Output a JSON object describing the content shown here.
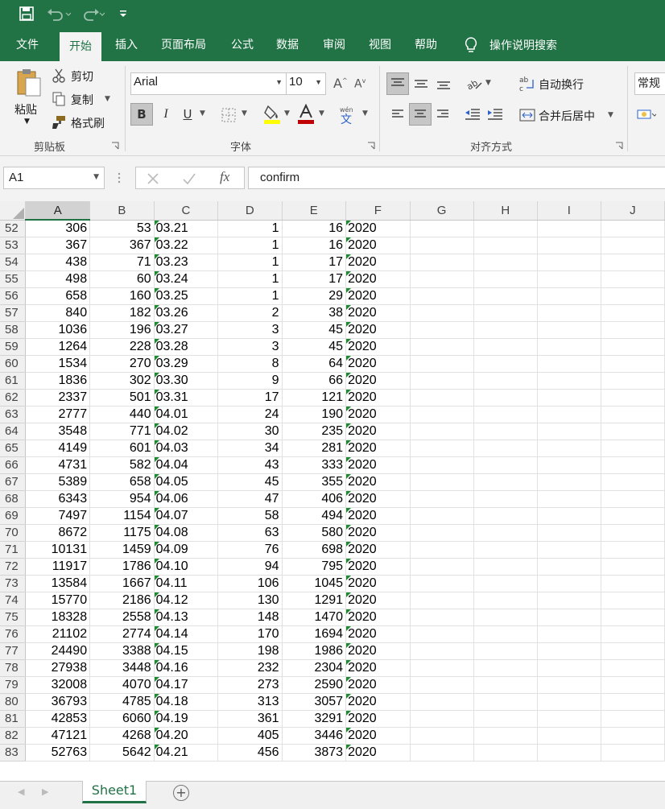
{
  "qat": {
    "save": "save-icon",
    "undo": "undo-icon",
    "redo": "redo-icon",
    "customize": "customize-qat-icon"
  },
  "menu": {
    "tabs": [
      "文件",
      "开始",
      "插入",
      "页面布局",
      "公式",
      "数据",
      "审阅",
      "视图",
      "帮助"
    ],
    "active_index": 1,
    "tellme": "操作说明搜索"
  },
  "ribbon": {
    "clipboard": {
      "paste": "粘贴",
      "cut": "剪切",
      "copy": "复制",
      "format_painter": "格式刷",
      "label": "剪贴板"
    },
    "font": {
      "name": "Arial",
      "size": "10",
      "bold": "B",
      "italic": "I",
      "underline": "U",
      "label": "字体"
    },
    "alignment": {
      "wrap": "自动换行",
      "merge": "合并后居中",
      "label": "对齐方式"
    },
    "number": {
      "format": "常规"
    }
  },
  "formula_bar": {
    "name_box": "A1",
    "fx": "fx",
    "content": "confirm"
  },
  "columns": [
    "A",
    "B",
    "C",
    "D",
    "E",
    "F",
    "G",
    "H",
    "I",
    "J"
  ],
  "rows": [
    {
      "r": "52",
      "a": "306",
      "b": "53",
      "c": "03.21",
      "d": "1",
      "e": "16",
      "f": "2020"
    },
    {
      "r": "53",
      "a": "367",
      "b": "367",
      "c": "03.22",
      "d": "1",
      "e": "16",
      "f": "2020"
    },
    {
      "r": "54",
      "a": "438",
      "b": "71",
      "c": "03.23",
      "d": "1",
      "e": "17",
      "f": "2020"
    },
    {
      "r": "55",
      "a": "498",
      "b": "60",
      "c": "03.24",
      "d": "1",
      "e": "17",
      "f": "2020"
    },
    {
      "r": "56",
      "a": "658",
      "b": "160",
      "c": "03.25",
      "d": "1",
      "e": "29",
      "f": "2020"
    },
    {
      "r": "57",
      "a": "840",
      "b": "182",
      "c": "03.26",
      "d": "2",
      "e": "38",
      "f": "2020"
    },
    {
      "r": "58",
      "a": "1036",
      "b": "196",
      "c": "03.27",
      "d": "3",
      "e": "45",
      "f": "2020"
    },
    {
      "r": "59",
      "a": "1264",
      "b": "228",
      "c": "03.28",
      "d": "3",
      "e": "45",
      "f": "2020"
    },
    {
      "r": "60",
      "a": "1534",
      "b": "270",
      "c": "03.29",
      "d": "8",
      "e": "64",
      "f": "2020"
    },
    {
      "r": "61",
      "a": "1836",
      "b": "302",
      "c": "03.30",
      "d": "9",
      "e": "66",
      "f": "2020"
    },
    {
      "r": "62",
      "a": "2337",
      "b": "501",
      "c": "03.31",
      "d": "17",
      "e": "121",
      "f": "2020"
    },
    {
      "r": "63",
      "a": "2777",
      "b": "440",
      "c": "04.01",
      "d": "24",
      "e": "190",
      "f": "2020"
    },
    {
      "r": "64",
      "a": "3548",
      "b": "771",
      "c": "04.02",
      "d": "30",
      "e": "235",
      "f": "2020"
    },
    {
      "r": "65",
      "a": "4149",
      "b": "601",
      "c": "04.03",
      "d": "34",
      "e": "281",
      "f": "2020"
    },
    {
      "r": "66",
      "a": "4731",
      "b": "582",
      "c": "04.04",
      "d": "43",
      "e": "333",
      "f": "2020"
    },
    {
      "r": "67",
      "a": "5389",
      "b": "658",
      "c": "04.05",
      "d": "45",
      "e": "355",
      "f": "2020"
    },
    {
      "r": "68",
      "a": "6343",
      "b": "954",
      "c": "04.06",
      "d": "47",
      "e": "406",
      "f": "2020"
    },
    {
      "r": "69",
      "a": "7497",
      "b": "1154",
      "c": "04.07",
      "d": "58",
      "e": "494",
      "f": "2020"
    },
    {
      "r": "70",
      "a": "8672",
      "b": "1175",
      "c": "04.08",
      "d": "63",
      "e": "580",
      "f": "2020"
    },
    {
      "r": "71",
      "a": "10131",
      "b": "1459",
      "c": "04.09",
      "d": "76",
      "e": "698",
      "f": "2020"
    },
    {
      "r": "72",
      "a": "11917",
      "b": "1786",
      "c": "04.10",
      "d": "94",
      "e": "795",
      "f": "2020"
    },
    {
      "r": "73",
      "a": "13584",
      "b": "1667",
      "c": "04.11",
      "d": "106",
      "e": "1045",
      "f": "2020"
    },
    {
      "r": "74",
      "a": "15770",
      "b": "2186",
      "c": "04.12",
      "d": "130",
      "e": "1291",
      "f": "2020"
    },
    {
      "r": "75",
      "a": "18328",
      "b": "2558",
      "c": "04.13",
      "d": "148",
      "e": "1470",
      "f": "2020"
    },
    {
      "r": "76",
      "a": "21102",
      "b": "2774",
      "c": "04.14",
      "d": "170",
      "e": "1694",
      "f": "2020"
    },
    {
      "r": "77",
      "a": "24490",
      "b": "3388",
      "c": "04.15",
      "d": "198",
      "e": "1986",
      "f": "2020"
    },
    {
      "r": "78",
      "a": "27938",
      "b": "3448",
      "c": "04.16",
      "d": "232",
      "e": "2304",
      "f": "2020"
    },
    {
      "r": "79",
      "a": "32008",
      "b": "4070",
      "c": "04.17",
      "d": "273",
      "e": "2590",
      "f": "2020"
    },
    {
      "r": "80",
      "a": "36793",
      "b": "4785",
      "c": "04.18",
      "d": "313",
      "e": "3057",
      "f": "2020"
    },
    {
      "r": "81",
      "a": "42853",
      "b": "6060",
      "c": "04.19",
      "d": "361",
      "e": "3291",
      "f": "2020"
    },
    {
      "r": "82",
      "a": "47121",
      "b": "4268",
      "c": "04.20",
      "d": "405",
      "e": "3446",
      "f": "2020"
    },
    {
      "r": "83",
      "a": "52763",
      "b": "5642",
      "c": "04.21",
      "d": "456",
      "e": "3873",
      "f": "2020"
    }
  ],
  "sheets": {
    "active": "Sheet1",
    "add": "add-sheet-icon"
  },
  "colors": {
    "accent": "#217346",
    "indicator": "#1e8a32",
    "font_color_bar": "#c00000",
    "fill_color_bar": "#ffff00"
  }
}
